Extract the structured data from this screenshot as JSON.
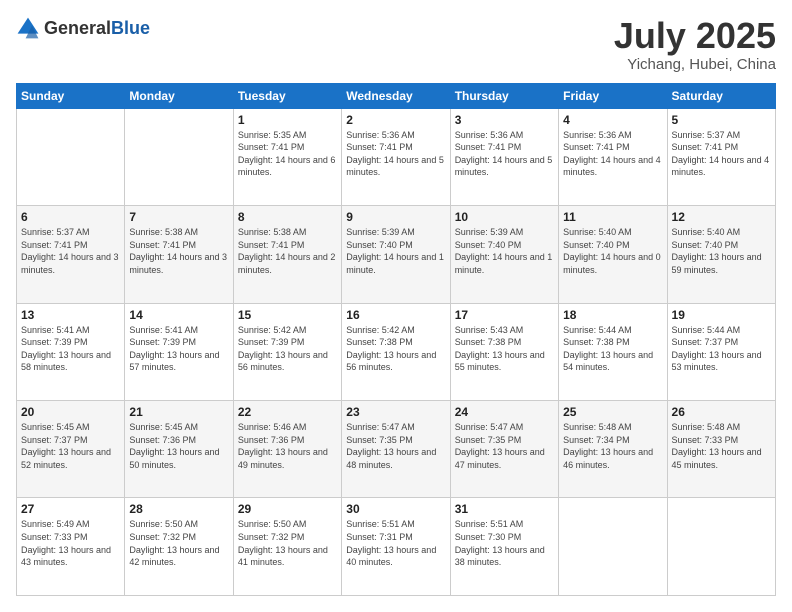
{
  "logo": {
    "general": "General",
    "blue": "Blue"
  },
  "header": {
    "month": "July 2025",
    "location": "Yichang, Hubei, China"
  },
  "weekdays": [
    "Sunday",
    "Monday",
    "Tuesday",
    "Wednesday",
    "Thursday",
    "Friday",
    "Saturday"
  ],
  "weeks": [
    [
      {
        "day": "",
        "info": ""
      },
      {
        "day": "",
        "info": ""
      },
      {
        "day": "1",
        "info": "Sunrise: 5:35 AM\nSunset: 7:41 PM\nDaylight: 14 hours\nand 6 minutes."
      },
      {
        "day": "2",
        "info": "Sunrise: 5:36 AM\nSunset: 7:41 PM\nDaylight: 14 hours\nand 5 minutes."
      },
      {
        "day": "3",
        "info": "Sunrise: 5:36 AM\nSunset: 7:41 PM\nDaylight: 14 hours\nand 5 minutes."
      },
      {
        "day": "4",
        "info": "Sunrise: 5:36 AM\nSunset: 7:41 PM\nDaylight: 14 hours\nand 4 minutes."
      },
      {
        "day": "5",
        "info": "Sunrise: 5:37 AM\nSunset: 7:41 PM\nDaylight: 14 hours\nand 4 minutes."
      }
    ],
    [
      {
        "day": "6",
        "info": "Sunrise: 5:37 AM\nSunset: 7:41 PM\nDaylight: 14 hours\nand 3 minutes."
      },
      {
        "day": "7",
        "info": "Sunrise: 5:38 AM\nSunset: 7:41 PM\nDaylight: 14 hours\nand 3 minutes."
      },
      {
        "day": "8",
        "info": "Sunrise: 5:38 AM\nSunset: 7:41 PM\nDaylight: 14 hours\nand 2 minutes."
      },
      {
        "day": "9",
        "info": "Sunrise: 5:39 AM\nSunset: 7:40 PM\nDaylight: 14 hours\nand 1 minute."
      },
      {
        "day": "10",
        "info": "Sunrise: 5:39 AM\nSunset: 7:40 PM\nDaylight: 14 hours\nand 1 minute."
      },
      {
        "day": "11",
        "info": "Sunrise: 5:40 AM\nSunset: 7:40 PM\nDaylight: 14 hours\nand 0 minutes."
      },
      {
        "day": "12",
        "info": "Sunrise: 5:40 AM\nSunset: 7:40 PM\nDaylight: 13 hours\nand 59 minutes."
      }
    ],
    [
      {
        "day": "13",
        "info": "Sunrise: 5:41 AM\nSunset: 7:39 PM\nDaylight: 13 hours\nand 58 minutes."
      },
      {
        "day": "14",
        "info": "Sunrise: 5:41 AM\nSunset: 7:39 PM\nDaylight: 13 hours\nand 57 minutes."
      },
      {
        "day": "15",
        "info": "Sunrise: 5:42 AM\nSunset: 7:39 PM\nDaylight: 13 hours\nand 56 minutes."
      },
      {
        "day": "16",
        "info": "Sunrise: 5:42 AM\nSunset: 7:38 PM\nDaylight: 13 hours\nand 56 minutes."
      },
      {
        "day": "17",
        "info": "Sunrise: 5:43 AM\nSunset: 7:38 PM\nDaylight: 13 hours\nand 55 minutes."
      },
      {
        "day": "18",
        "info": "Sunrise: 5:44 AM\nSunset: 7:38 PM\nDaylight: 13 hours\nand 54 minutes."
      },
      {
        "day": "19",
        "info": "Sunrise: 5:44 AM\nSunset: 7:37 PM\nDaylight: 13 hours\nand 53 minutes."
      }
    ],
    [
      {
        "day": "20",
        "info": "Sunrise: 5:45 AM\nSunset: 7:37 PM\nDaylight: 13 hours\nand 52 minutes."
      },
      {
        "day": "21",
        "info": "Sunrise: 5:45 AM\nSunset: 7:36 PM\nDaylight: 13 hours\nand 50 minutes."
      },
      {
        "day": "22",
        "info": "Sunrise: 5:46 AM\nSunset: 7:36 PM\nDaylight: 13 hours\nand 49 minutes."
      },
      {
        "day": "23",
        "info": "Sunrise: 5:47 AM\nSunset: 7:35 PM\nDaylight: 13 hours\nand 48 minutes."
      },
      {
        "day": "24",
        "info": "Sunrise: 5:47 AM\nSunset: 7:35 PM\nDaylight: 13 hours\nand 47 minutes."
      },
      {
        "day": "25",
        "info": "Sunrise: 5:48 AM\nSunset: 7:34 PM\nDaylight: 13 hours\nand 46 minutes."
      },
      {
        "day": "26",
        "info": "Sunrise: 5:48 AM\nSunset: 7:33 PM\nDaylight: 13 hours\nand 45 minutes."
      }
    ],
    [
      {
        "day": "27",
        "info": "Sunrise: 5:49 AM\nSunset: 7:33 PM\nDaylight: 13 hours\nand 43 minutes."
      },
      {
        "day": "28",
        "info": "Sunrise: 5:50 AM\nSunset: 7:32 PM\nDaylight: 13 hours\nand 42 minutes."
      },
      {
        "day": "29",
        "info": "Sunrise: 5:50 AM\nSunset: 7:32 PM\nDaylight: 13 hours\nand 41 minutes."
      },
      {
        "day": "30",
        "info": "Sunrise: 5:51 AM\nSunset: 7:31 PM\nDaylight: 13 hours\nand 40 minutes."
      },
      {
        "day": "31",
        "info": "Sunrise: 5:51 AM\nSunset: 7:30 PM\nDaylight: 13 hours\nand 38 minutes."
      },
      {
        "day": "",
        "info": ""
      },
      {
        "day": "",
        "info": ""
      }
    ]
  ]
}
